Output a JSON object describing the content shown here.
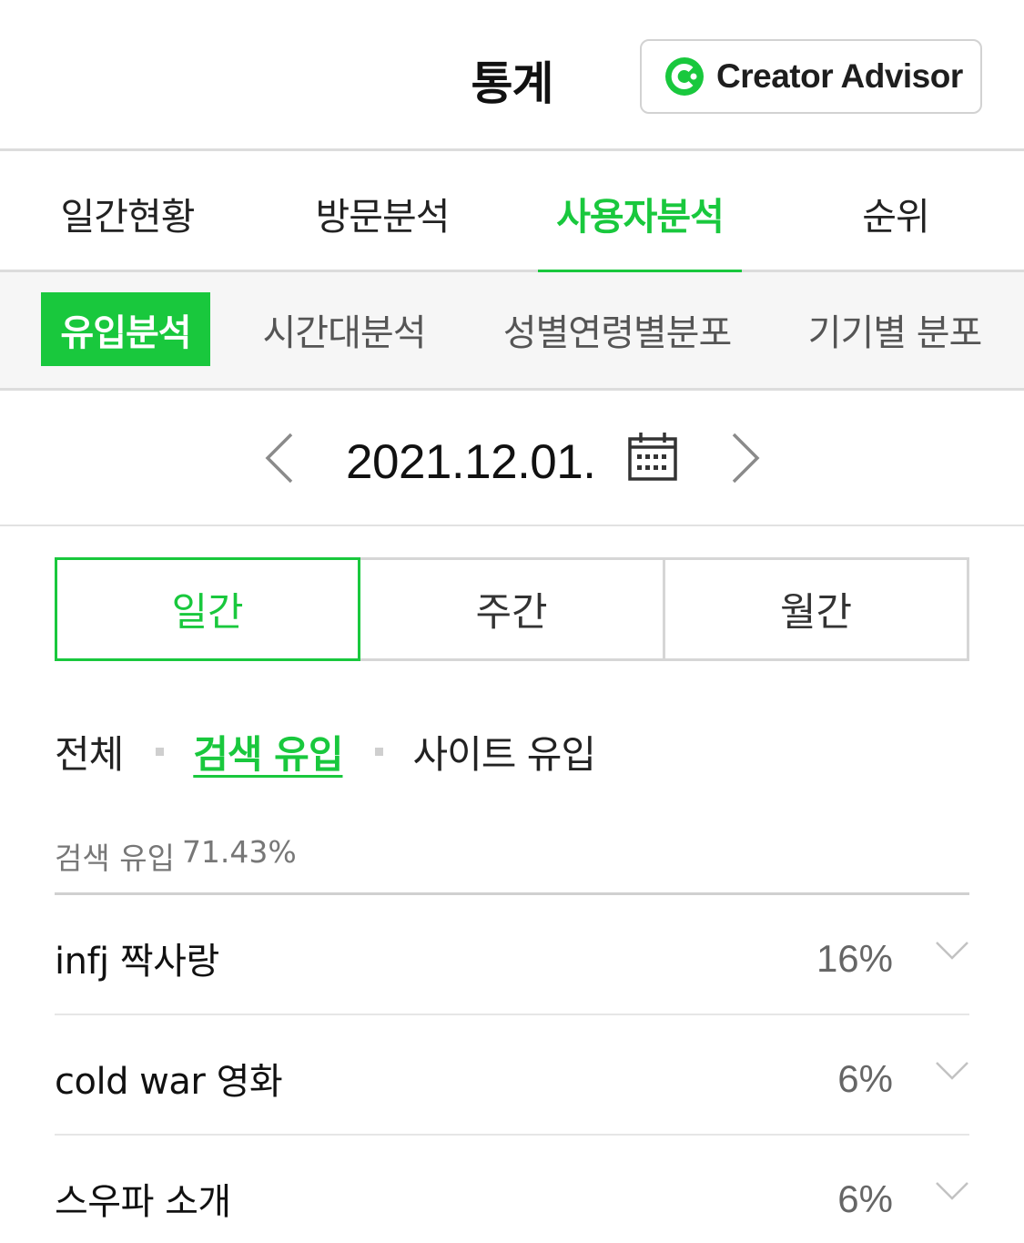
{
  "header": {
    "title": "통계",
    "creator_advisor_label": "Creator Advisor",
    "logo_icon": "creator-advisor-logo-icon",
    "accent_color": "#19c83d"
  },
  "main_tabs": [
    {
      "label": "일간현황",
      "active": false
    },
    {
      "label": "방문분석",
      "active": false
    },
    {
      "label": "사용자분석",
      "active": true
    },
    {
      "label": "순위",
      "active": false
    }
  ],
  "sub_tabs": [
    {
      "label": "유입분석",
      "active": true
    },
    {
      "label": "시간대분석",
      "active": false
    },
    {
      "label": "성별연령별분포",
      "active": false
    },
    {
      "label": "기기별 분포",
      "active": false
    }
  ],
  "date_nav": {
    "date": "2021.12.01.",
    "prev_icon": "chevron-left-icon",
    "next_icon": "chevron-right-icon",
    "calendar_icon": "calendar-icon"
  },
  "period": [
    {
      "label": "일간",
      "active": true
    },
    {
      "label": "주간",
      "active": false
    },
    {
      "label": "월간",
      "active": false
    }
  ],
  "filter": [
    {
      "label": "전체",
      "active": false
    },
    {
      "label": "검색 유입",
      "active": true
    },
    {
      "label": "사이트 유입",
      "active": false
    }
  ],
  "summary": {
    "label": "검색 유입",
    "value": "71.43%"
  },
  "keywords": [
    {
      "label": "infj 짝사랑",
      "percent": "16%"
    },
    {
      "label": "cold war 영화",
      "percent": "6%"
    },
    {
      "label": "스우파 소개",
      "percent": "6%"
    }
  ]
}
